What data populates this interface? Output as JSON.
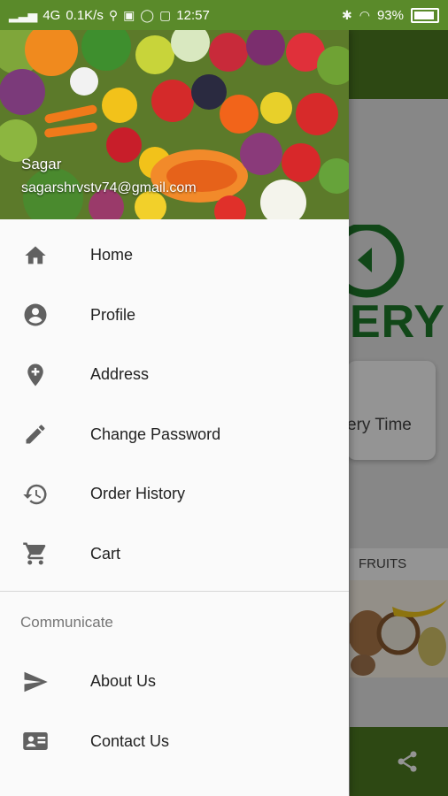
{
  "status_bar": {
    "network": "4G",
    "speed": "0.1K/s",
    "time": "12:57",
    "battery": "93%"
  },
  "background": {
    "logo_text": "ERY",
    "delivery_text": "ery Time",
    "fruits_label": "FRUITS"
  },
  "drawer": {
    "header": {
      "name": "Sagar",
      "email": "sagarshrvstv74@gmail.com"
    },
    "menu": [
      {
        "label": "Home",
        "icon": "home-icon"
      },
      {
        "label": "Profile",
        "icon": "account-circle-icon"
      },
      {
        "label": "Address",
        "icon": "add-location-icon"
      },
      {
        "label": "Change Password",
        "icon": "pencil-icon"
      },
      {
        "label": "Order History",
        "icon": "history-icon"
      },
      {
        "label": "Cart",
        "icon": "cart-icon"
      }
    ],
    "section_title": "Communicate",
    "communicate": [
      {
        "label": "About Us",
        "icon": "send-icon"
      },
      {
        "label": "Contact Us",
        "icon": "contact-card-icon"
      }
    ]
  },
  "colors": {
    "status_bar": "#5a8a2a",
    "toolbar": "#4f7d22",
    "icon_gray": "#616161"
  }
}
